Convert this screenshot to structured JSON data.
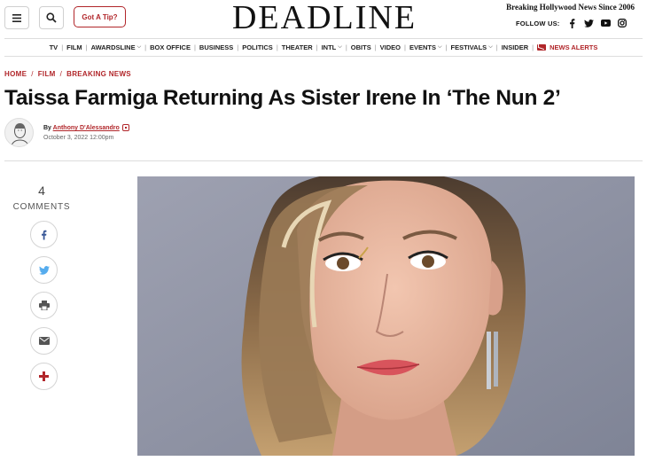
{
  "header": {
    "menu_icon": "hamburger-icon",
    "search_icon": "search-icon",
    "tip_button": "Got A Tip?",
    "logo": "DEADLINE",
    "tagline": "Breaking Hollywood News Since 2006",
    "follow_label": "FOLLOW US:",
    "social_icons": [
      "facebook-icon",
      "twitter-icon",
      "youtube-icon",
      "instagram-icon"
    ]
  },
  "nav": {
    "items": [
      {
        "label": "TV",
        "caret": false
      },
      {
        "label": "FILM",
        "caret": false
      },
      {
        "label": "AWARDSLINE",
        "caret": true
      },
      {
        "label": "BOX OFFICE",
        "caret": false
      },
      {
        "label": "BUSINESS",
        "caret": false
      },
      {
        "label": "POLITICS",
        "caret": false
      },
      {
        "label": "THEATER",
        "caret": false
      },
      {
        "label": "INTL",
        "caret": true
      },
      {
        "label": "OBITS",
        "caret": false
      },
      {
        "label": "VIDEO",
        "caret": false
      },
      {
        "label": "EVENTS",
        "caret": true
      },
      {
        "label": "FESTIVALS",
        "caret": true
      },
      {
        "label": "INSIDER",
        "caret": false
      }
    ],
    "alerts_label": "NEWS ALERTS"
  },
  "breadcrumb": [
    "HOME",
    "FILM",
    "BREAKING NEWS"
  ],
  "article": {
    "headline": "Taissa Farmiga Returning As Sister Irene In ‘The Nun 2’",
    "by_prefix": "By",
    "author": "Anthony D'Alessandro",
    "date": "October 3, 2022 12:00pm"
  },
  "share": {
    "comment_count": "4",
    "comments_label": "COMMENTS",
    "buttons": [
      "facebook-icon",
      "twitter-icon",
      "print-icon",
      "email-icon",
      "plus-icon"
    ]
  },
  "colors": {
    "accent": "#b1262a",
    "facebook": "#3b5998",
    "twitter": "#55acee"
  }
}
